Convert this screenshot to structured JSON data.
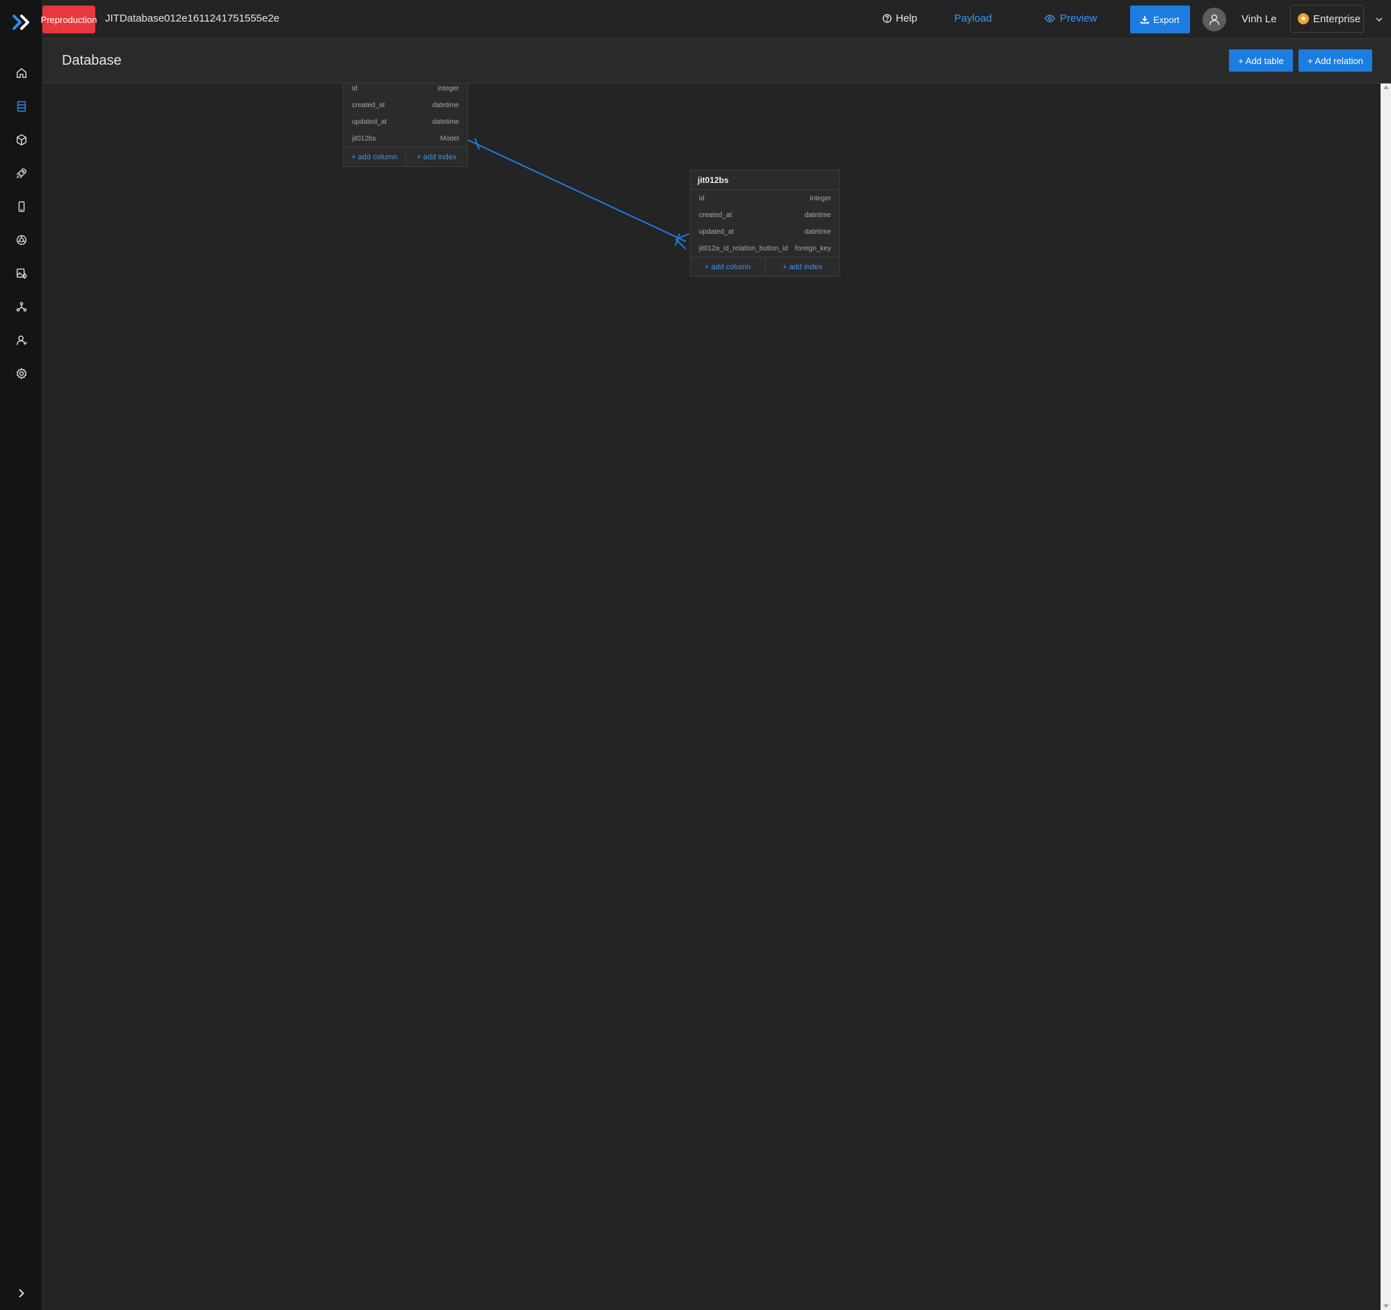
{
  "topbar": {
    "environment": "Preproduction",
    "app_name": "JITDatabase012e1611241751555e2e",
    "help_label": "Help",
    "payload_label": "Payload",
    "preview_label": "Preview",
    "export_label": "Export",
    "user_name": "Vinh Le",
    "plan_label": "Enterprise"
  },
  "sidebar": {
    "items": [
      {
        "icon": "home-icon"
      },
      {
        "icon": "database-icon",
        "active": true
      },
      {
        "icon": "cube-icon"
      },
      {
        "icon": "rocket-icon"
      },
      {
        "icon": "mobile-icon"
      },
      {
        "icon": "theme-icon"
      },
      {
        "icon": "media-icon"
      },
      {
        "icon": "integration-icon"
      },
      {
        "icon": "users-icon"
      },
      {
        "icon": "settings-icon"
      }
    ]
  },
  "page": {
    "title": "Database",
    "add_table_label": "+ Add table",
    "add_relation_label": "+ Add relation"
  },
  "tables": [
    {
      "name": "",
      "columns": [
        {
          "name": "id",
          "type": "integer"
        },
        {
          "name": "created_at",
          "type": "datetime"
        },
        {
          "name": "updated_at",
          "type": "datetime"
        },
        {
          "name": "jit012bs",
          "type": "Model"
        }
      ],
      "add_column_label": "+ add column",
      "add_index_label": "+ add index"
    },
    {
      "name": "jit012bs",
      "columns": [
        {
          "name": "id",
          "type": "integer"
        },
        {
          "name": "created_at",
          "type": "datetime"
        },
        {
          "name": "updated_at",
          "type": "datetime"
        },
        {
          "name": "jit012a_id_relation_button_id",
          "type": "foreign_key"
        }
      ],
      "add_column_label": "+ add column",
      "add_index_label": "+ add index"
    }
  ],
  "colors": {
    "accent": "#1c7de0",
    "environment_badge": "#e8383d",
    "relation_line": "#1c7de0"
  }
}
